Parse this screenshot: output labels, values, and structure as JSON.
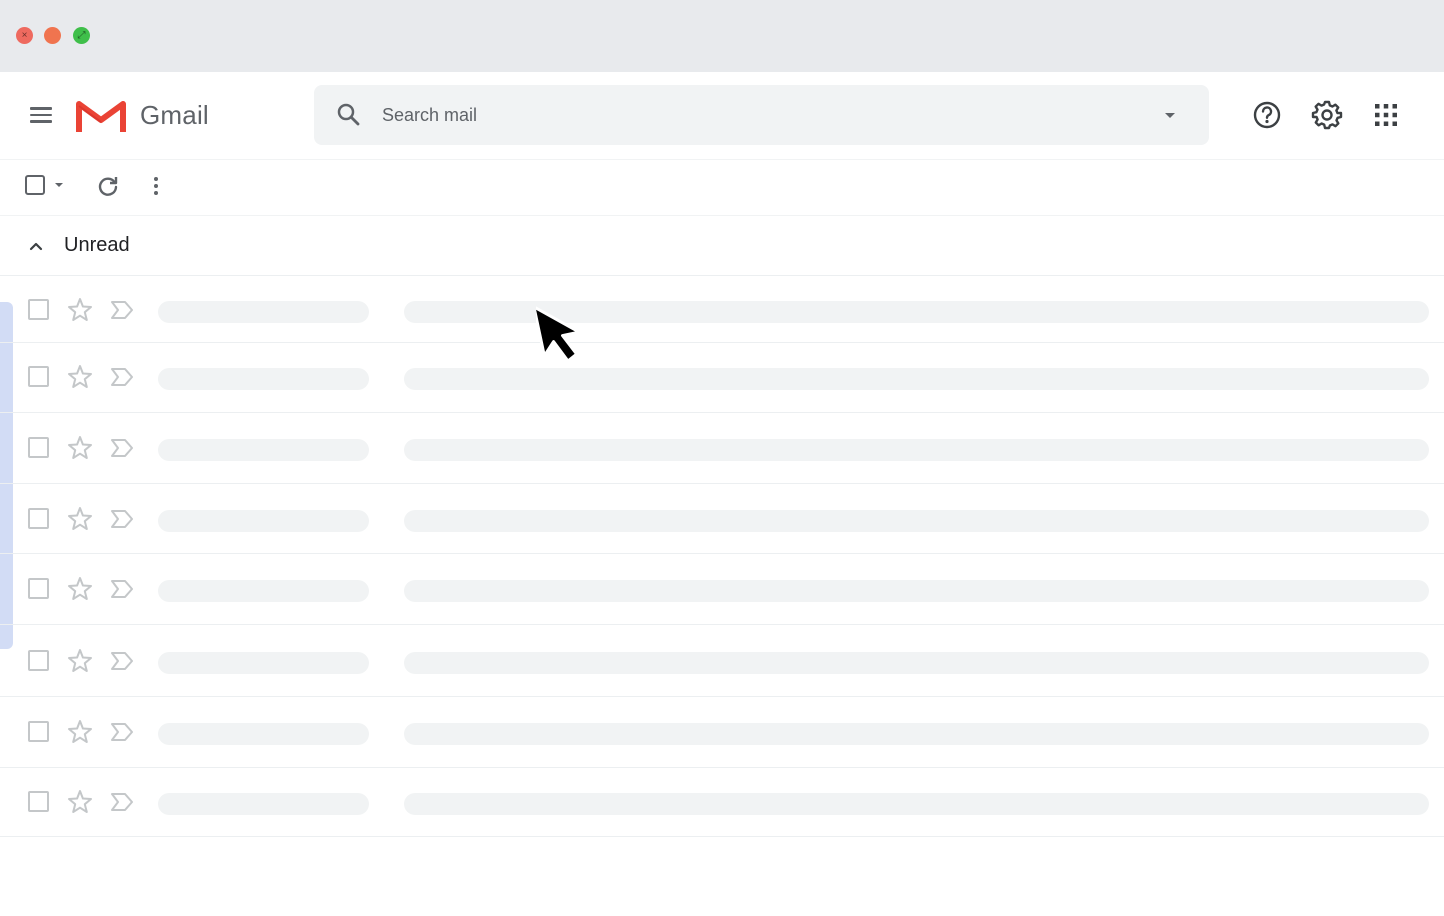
{
  "window": {
    "buttons": [
      "close",
      "minimize",
      "maximize"
    ],
    "glyphs": {
      "close": "×",
      "minimize": "",
      "maximize": "⤢"
    }
  },
  "header": {
    "brand": "Gmail",
    "search": {
      "placeholder": "Search mail",
      "value": ""
    },
    "icons": [
      "menu-icon",
      "gmail-logo",
      "search-icon",
      "dropdown-arrow-icon",
      "help-icon",
      "settings-icon",
      "apps-grid-icon"
    ]
  },
  "toolbar": {
    "icons": [
      "select-checkbox",
      "select-caret-icon",
      "refresh-icon",
      "more-vert-icon"
    ]
  },
  "section": {
    "title": "Unread",
    "collapsed": false
  },
  "list": {
    "loading": true,
    "row_count": 8
  },
  "colors": {
    "titlebar": "#e8eaed",
    "close": "#ee6a5f",
    "minimize": "#f0744f",
    "maximize": "#3fbf4a",
    "gmail_red": "#ea4335",
    "placeholder": "#f1f3f4",
    "accent": "#d2dcf5"
  }
}
